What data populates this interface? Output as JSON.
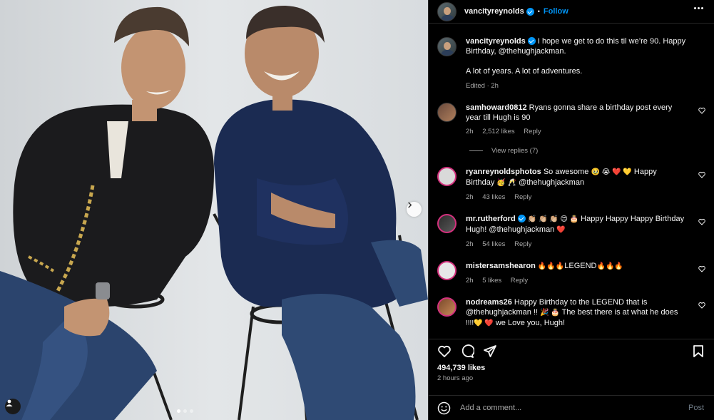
{
  "post": {
    "username": "vancityreynolds",
    "follow_label": "Follow",
    "caption_line1": "I hope we get to do this til we’re 90. Happy",
    "caption_line2": "Birthday, @thehughjackman.",
    "caption_line3": "A lot of years. A lot of adventures.",
    "caption_meta": "Edited · 2h",
    "likes": "494,739 likes",
    "time": "2 hours ago",
    "add_comment_placeholder": "Add a comment...",
    "post_label": "Post"
  },
  "comments": [
    {
      "username": "samhoward0812",
      "line1": "Ryans gonna share a birthday post every",
      "line2": "year till Hugh is 90",
      "time": "2h",
      "likes": "2,512 likes",
      "reply": "Reply",
      "view_replies": "View replies (7)"
    },
    {
      "username": "ryanreynoldsphotos",
      "line1_text": "So awesome",
      "line1_emoji": "🥹 😭 ❤️ 💛",
      "line1_tail": "Happy",
      "line2_head": "Birthday",
      "line2_emoji": "🥳 🥂",
      "line2_tail": "@thehughjackman",
      "time": "2h",
      "likes": "43 likes",
      "reply": "Reply"
    },
    {
      "username": "mr.rutherford",
      "line1_emoji": "👏🏼 👏🏼 👏🏼 😍 🎂",
      "line1_text": "Happy Happy Happy Birthday",
      "line2_text": "Hugh! @thehughjackman",
      "line2_emoji": "❤️",
      "time": "2h",
      "likes": "54 likes",
      "reply": "Reply"
    },
    {
      "username": "mistersamshearon",
      "emoji_a": "🔥🔥🔥",
      "text": "LEGEND",
      "emoji_b": "🔥🔥🔥",
      "time": "2h",
      "likes": "5 likes",
      "reply": "Reply"
    },
    {
      "username": "nodreams26",
      "line1": "Happy Birthday to the LEGEND that is",
      "line2_a": "@thehughjackman !!",
      "line2_emoji": "🎉 🎂",
      "line2_b": "The best there is at what he does",
      "line3_emoji": "!!!!💛 ❤️",
      "line3_text": "we Love you, Hugh!"
    }
  ],
  "icons": {
    "like": "heart-icon",
    "comment": "comment-icon",
    "share": "share-icon",
    "save": "bookmark-icon",
    "emoji": "smiley-icon",
    "more": "more-options-icon",
    "next": "chevron-right-icon",
    "tags": "user-tag-icon"
  },
  "colors": {
    "accent": "#0095f6",
    "background": "#000000",
    "divider": "#262626",
    "secondary_text": "#a8a8a8"
  }
}
